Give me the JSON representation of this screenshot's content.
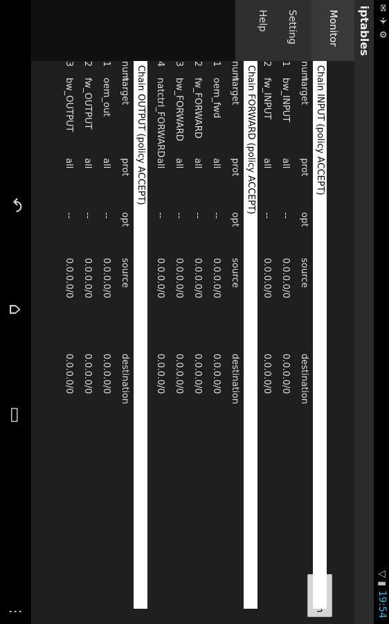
{
  "status": {
    "left_icons": "✉ ✈ ⚙",
    "time": "19:54",
    "signal": "▽ ▮"
  },
  "app": {
    "title": "iptables"
  },
  "tabs": [
    {
      "label": "Monitor"
    },
    {
      "label": "Setting"
    },
    {
      "label": "Help"
    }
  ],
  "toolbar": {
    "refresh_label": "Refresh"
  },
  "columns": {
    "num": "num",
    "target": "target",
    "prot": "prot",
    "opt": "opt",
    "source": "source",
    "destination": "destination"
  },
  "chains": [
    {
      "title": "Chain INPUT (policy ACCEPT)",
      "rows": [
        {
          "num": "1",
          "target": "bw_INPUT",
          "prot": "all",
          "opt": "--",
          "source": "0.0.0.0/0",
          "destination": "0.0.0.0/0"
        },
        {
          "num": "2",
          "target": "fw_INPUT",
          "prot": "all",
          "opt": "--",
          "source": "0.0.0.0/0",
          "destination": "0.0.0.0/0"
        }
      ]
    },
    {
      "title": "Chain FORWARD (policy ACCEPT)",
      "rows": [
        {
          "num": "1",
          "target": "oem_fwd",
          "prot": "all",
          "opt": "--",
          "source": "0.0.0.0/0",
          "destination": "0.0.0.0/0"
        },
        {
          "num": "2",
          "target": "fw_FORWARD",
          "prot": "all",
          "opt": "--",
          "source": "0.0.0.0/0",
          "destination": "0.0.0.0/0"
        },
        {
          "num": "3",
          "target": "bw_FORWARD",
          "prot": "all",
          "opt": "--",
          "source": "0.0.0.0/0",
          "destination": "0.0.0.0/0"
        },
        {
          "num": "4",
          "target": "natctrl_FORWARD",
          "prot": "all",
          "opt": "--",
          "source": "0.0.0.0/0",
          "destination": "0.0.0.0/0"
        }
      ]
    },
    {
      "title": "Chain OUTPUT (policy ACCEPT)",
      "rows": [
        {
          "num": "1",
          "target": "oem_out",
          "prot": "all",
          "opt": "--",
          "source": "0.0.0.0/0",
          "destination": "0.0.0.0/0"
        },
        {
          "num": "2",
          "target": "fw_OUTPUT",
          "prot": "all",
          "opt": "--",
          "source": "0.0.0.0/0",
          "destination": "0.0.0.0/0"
        },
        {
          "num": "3",
          "target": "bw_OUTPUT",
          "prot": "all",
          "opt": "--",
          "source": "0.0.0.0/0",
          "destination": "0.0.0.0/0"
        }
      ]
    }
  ],
  "navbar": {
    "back": "↶",
    "home": "⌂",
    "recents": "▭",
    "menu": "⋮"
  }
}
